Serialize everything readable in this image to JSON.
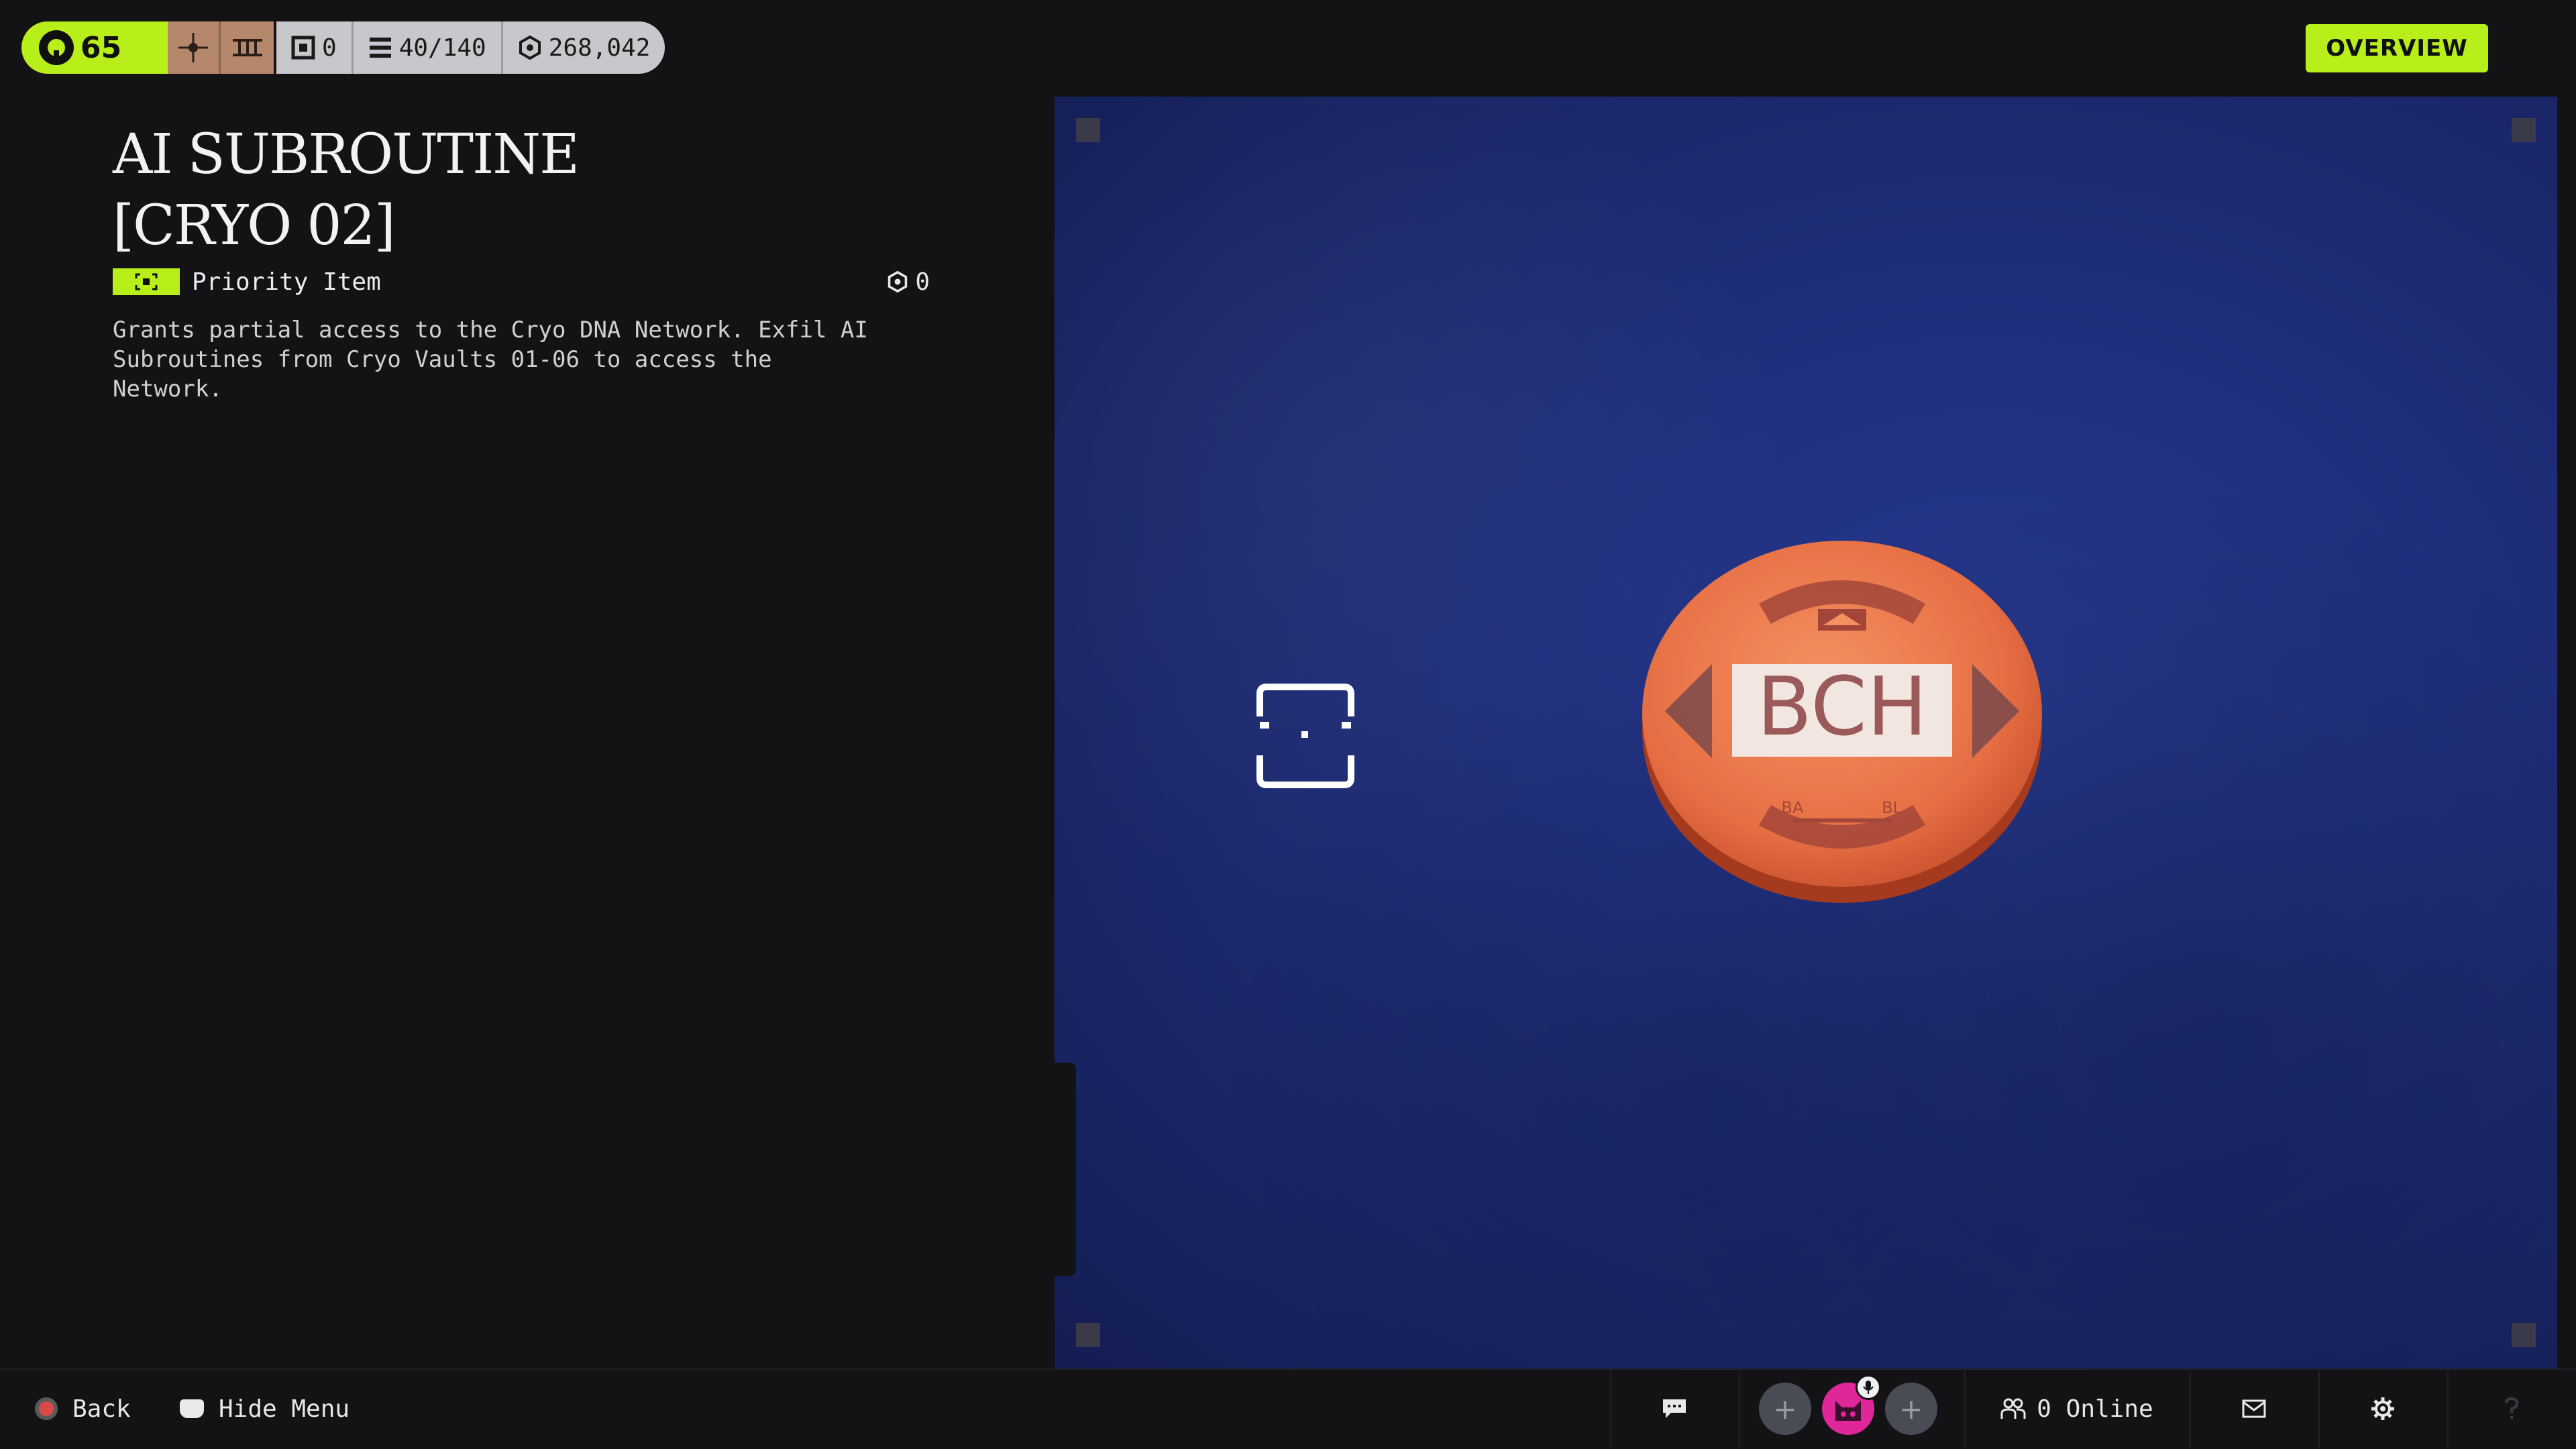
{
  "hud": {
    "level": "65",
    "mods": [
      "target-mod-icon",
      "vault-mod-icon"
    ],
    "stats": [
      {
        "icon": "backpack-icon",
        "value": "0"
      },
      {
        "icon": "stack-icon",
        "value": "40/140"
      },
      {
        "icon": "currency-icon",
        "value": "268,042"
      }
    ]
  },
  "overview_label": "OVERVIEW",
  "item": {
    "title_line1": "AI SUBROUTINE",
    "title_line2": "[CRYO 02]",
    "tag": "Priority Item",
    "value": "0",
    "description": "Grants partial access to the Cryo DNA Network. Exfil AI\nSubroutines from Cryo Vaults 01-06 to access the\nNetwork."
  },
  "coin": {
    "label": "BCH",
    "sub_left": "BA",
    "sub_right": "BL",
    "color": "#e8764a"
  },
  "bottom": {
    "back_label": "Back",
    "hide_label": "Hide Menu",
    "online_label": "0 Online"
  },
  "colors": {
    "accent": "#b8ee1a",
    "preview_bg": "#1f2f7d",
    "avatar": "#e0279a"
  }
}
